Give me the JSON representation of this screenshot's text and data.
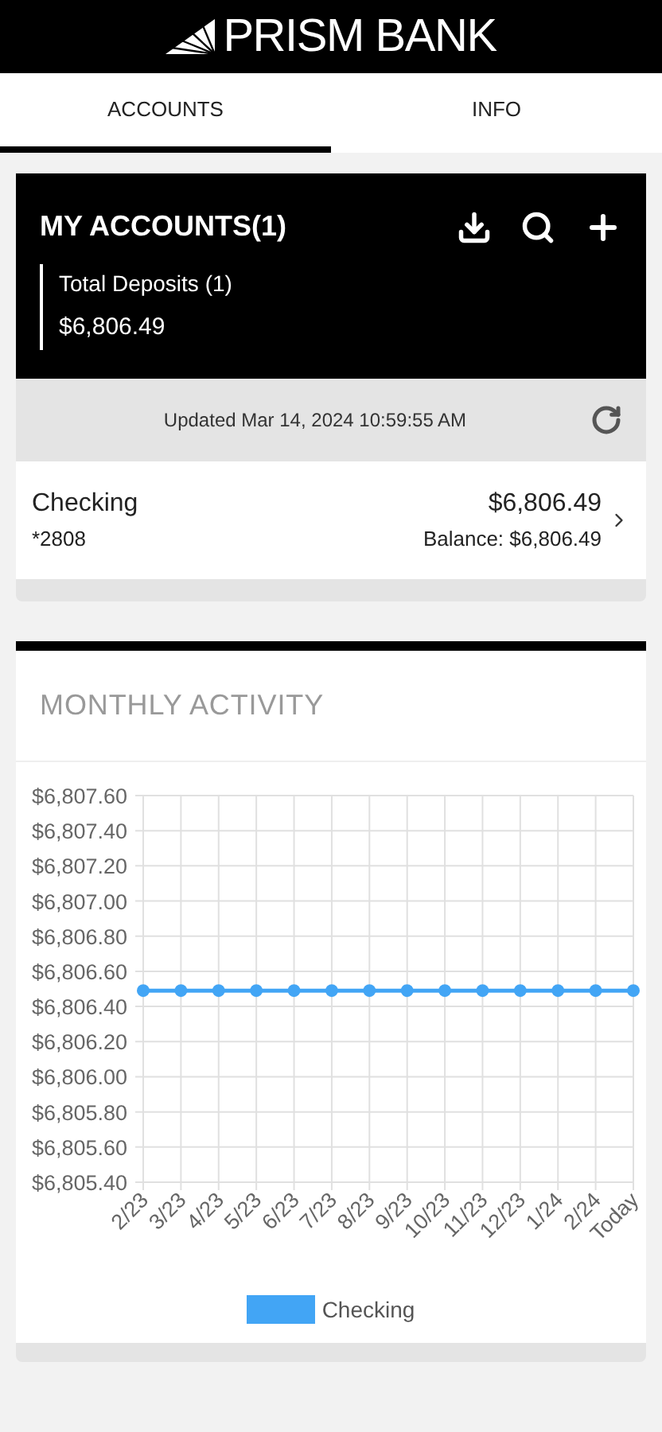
{
  "header": {
    "title": "PRISM BANK"
  },
  "tabs": [
    {
      "label": "ACCOUNTS",
      "selected": true
    },
    {
      "label": "INFO",
      "selected": false
    }
  ],
  "accounts_panel": {
    "title": "MY ACCOUNTS(1)",
    "summary_label": "Total Deposits (1)",
    "summary_amount": "$6,806.49",
    "updated": "Updated Mar 14, 2024 10:59:55 AM",
    "accounts": [
      {
        "name": "Checking",
        "number": "*2808",
        "amount": "$6,806.49",
        "balance": "Balance: $6,806.49"
      }
    ]
  },
  "activity": {
    "title": "MONTHLY ACTIVITY",
    "chart_data": {
      "type": "line",
      "grid": true,
      "categories": [
        "2/23",
        "3/23",
        "4/23",
        "5/23",
        "6/23",
        "7/23",
        "8/23",
        "9/23",
        "10/23",
        "11/23",
        "12/23",
        "1/24",
        "2/24",
        "Today"
      ],
      "series": [
        {
          "name": "Checking",
          "color": "#42a5f5",
          "marker": "circle",
          "values": [
            6806.49,
            6806.49,
            6806.49,
            6806.49,
            6806.49,
            6806.49,
            6806.49,
            6806.49,
            6806.49,
            6806.49,
            6806.49,
            6806.49,
            6806.49,
            6806.49
          ]
        }
      ],
      "ylim": [
        6805.4,
        6807.6
      ],
      "yticks": [
        {
          "value": 6807.6,
          "label": "$6,807.60"
        },
        {
          "value": 6807.4,
          "label": "$6,807.40"
        },
        {
          "value": 6807.2,
          "label": "$6,807.20"
        },
        {
          "value": 6807.0,
          "label": "$6,807.00"
        },
        {
          "value": 6806.8,
          "label": "$6,806.80"
        },
        {
          "value": 6806.6,
          "label": "$6,806.60"
        },
        {
          "value": 6806.4,
          "label": "$6,806.40"
        },
        {
          "value": 6806.2,
          "label": "$6,806.20"
        },
        {
          "value": 6806.0,
          "label": "$6,806.00"
        },
        {
          "value": 6805.8,
          "label": "$6,805.80"
        },
        {
          "value": 6805.6,
          "label": "$6,805.60"
        },
        {
          "value": 6805.4,
          "label": "$6,805.40"
        }
      ]
    }
  }
}
